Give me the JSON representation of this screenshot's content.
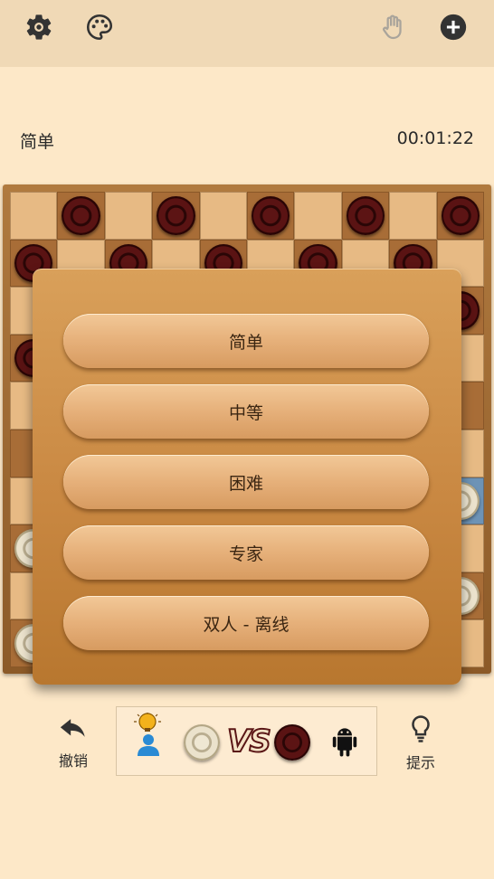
{
  "topbar": {
    "settings_icon": "gear-icon",
    "theme_icon": "palette-icon",
    "hand_icon": "hand-icon",
    "add_icon": "plus-circle-icon"
  },
  "status": {
    "level": "简单",
    "timer": "00:01:22"
  },
  "board": {
    "rows": [
      [
        "",
        "",
        "",
        "",
        "",
        "",
        "",
        "",
        "",
        ""
      ],
      [
        "",
        "",
        "",
        "",
        "",
        "",
        "",
        "",
        "",
        ""
      ],
      [
        "",
        "",
        "",
        "",
        "",
        "",
        "",
        "",
        "",
        ""
      ],
      [
        "",
        "",
        "",
        "",
        "",
        "",
        "",
        "",
        "",
        ""
      ],
      [
        "",
        "",
        "",
        "",
        "",
        "",
        "",
        "",
        "",
        ""
      ],
      [
        "",
        "",
        "",
        "",
        "",
        "",
        "",
        "",
        "",
        ""
      ],
      [
        "",
        "",
        "",
        "",
        "",
        "",
        "",
        "",
        "",
        ""
      ],
      [
        "",
        "",
        "",
        "",
        "",
        "",
        "",
        "",
        "",
        ""
      ],
      [
        "",
        "",
        "",
        "",
        "",
        "",
        "",
        "",
        "",
        ""
      ],
      [
        "",
        "",
        "",
        "",
        "",
        "",
        "",
        "",
        "",
        ""
      ]
    ],
    "highlight_square": [
      6,
      9
    ]
  },
  "menu": {
    "options": [
      "简单",
      "中等",
      "困难",
      "专家",
      "双人 - 离线"
    ]
  },
  "bottom": {
    "undo_label": "撤销",
    "hint_label": "提示",
    "vs_text": "VS",
    "player_icon": "person-with-lightbulb-icon",
    "opponent_icon": "android-icon"
  },
  "colors": {
    "background": "#fde8c8",
    "topbar": "#f0d9b6",
    "dark_piece": "#4a0d0d",
    "light_piece": "#e6dcc2",
    "player_blue": "#2a8ad4"
  }
}
